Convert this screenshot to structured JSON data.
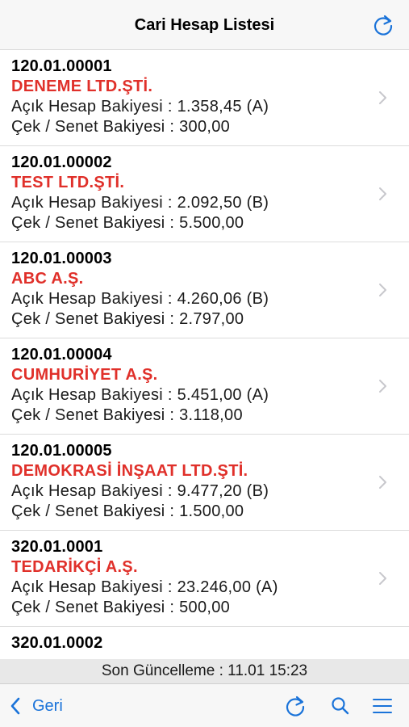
{
  "header": {
    "title": "Cari Hesap Listesi",
    "refresh_icon": "refresh-icon"
  },
  "accounts": [
    {
      "code": "120.01.00001",
      "name": "DENEME LTD.ŞTİ.",
      "open_balance": "Açık Hesap Bakiyesi : 1.358,45 (A)",
      "check_balance": "Çek / Senet Bakiyesi : 300,00"
    },
    {
      "code": "120.01.00002",
      "name": "TEST LTD.ŞTİ.",
      "open_balance": "Açık Hesap Bakiyesi : 2.092,50 (B)",
      "check_balance": "Çek / Senet Bakiyesi : 5.500,00"
    },
    {
      "code": "120.01.00003",
      "name": "ABC A.Ş.",
      "open_balance": "Açık Hesap Bakiyesi : 4.260,06 (B)",
      "check_balance": "Çek / Senet Bakiyesi : 2.797,00"
    },
    {
      "code": "120.01.00004",
      "name": "CUMHURİYET A.Ş.",
      "open_balance": "Açık Hesap Bakiyesi : 5.451,00 (A)",
      "check_balance": "Çek / Senet Bakiyesi : 3.118,00"
    },
    {
      "code": "120.01.00005",
      "name": "DEMOKRASİ İNŞAAT LTD.ŞTİ.",
      "open_balance": "Açık Hesap Bakiyesi : 9.477,20 (B)",
      "check_balance": "Çek / Senet Bakiyesi : 1.500,00"
    },
    {
      "code": "320.01.0001",
      "name": "TEDARİKÇİ A.Ş.",
      "open_balance": "Açık Hesap Bakiyesi : 23.246,00 (A)",
      "check_balance": "Çek / Senet Bakiyesi : 500,00"
    },
    {
      "code": "320.01.0002",
      "name": "",
      "open_balance": "",
      "check_balance": ""
    }
  ],
  "status": {
    "last_update": "Son Güncelleme : 11.01 15:23"
  },
  "toolbar": {
    "back_label": "Geri",
    "icons": [
      "chevron-left-icon",
      "refresh-icon",
      "search-icon",
      "menu-icon"
    ]
  },
  "colors": {
    "accent": "#1a73d9",
    "name_red": "#e0302a",
    "nav_bg": "#f7f7f7",
    "status_bg": "#e8e8e8"
  }
}
